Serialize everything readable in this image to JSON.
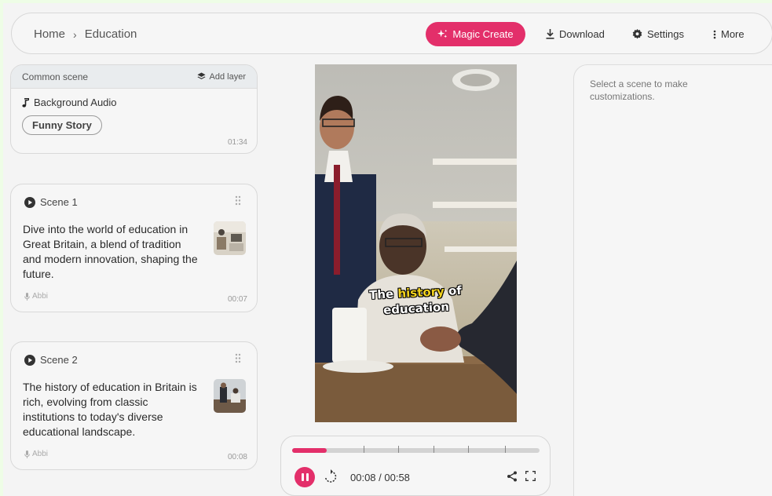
{
  "breadcrumb": {
    "home": "Home",
    "separator": "›",
    "current": "Education"
  },
  "toolbar": {
    "magic_create": "Magic Create",
    "download": "Download",
    "settings": "Settings",
    "more": "More"
  },
  "common_scene": {
    "title": "Common scene",
    "add_layer": "Add layer",
    "audio_label": "Background Audio",
    "audio_tag": "Funny Story",
    "duration": "01:34"
  },
  "scenes": [
    {
      "title": "Scene 1",
      "text": "Dive into the world of education in Great Britain, a blend of tradition and modern innovation, shaping the future.",
      "voice": "Abbi",
      "duration": "00:07"
    },
    {
      "title": "Scene 2",
      "text": "The history of education in Britain is rich, evolving from classic institutions to today's diverse educational landscape.",
      "voice": "Abbi",
      "duration": "00:08"
    }
  ],
  "video": {
    "caption_part1": "The ",
    "caption_highlight": "history",
    "caption_part2": " of",
    "caption_line2": "education"
  },
  "player": {
    "current_time": "00:08",
    "total_time": "00:58",
    "time_display": "00:08 / 00:58",
    "progress": 0.14,
    "marker_positions": [
      0.29,
      0.43,
      0.57,
      0.71,
      0.86
    ]
  },
  "right_panel": {
    "message": "Select a scene to make customizations."
  },
  "colors": {
    "accent": "#e32f6a",
    "background": "#f4f4f4",
    "page_border": "#eefde6",
    "caption_highlight": "#f2d21e"
  },
  "icons": [
    "chevron-right-icon",
    "sparkle-icon",
    "download-icon",
    "gear-icon",
    "more-vertical-icon",
    "layers-icon",
    "music-note-icon",
    "play-circle-icon",
    "drag-handle-icon",
    "microphone-icon",
    "pause-icon",
    "replay-icon",
    "share-icon",
    "fullscreen-icon"
  ]
}
